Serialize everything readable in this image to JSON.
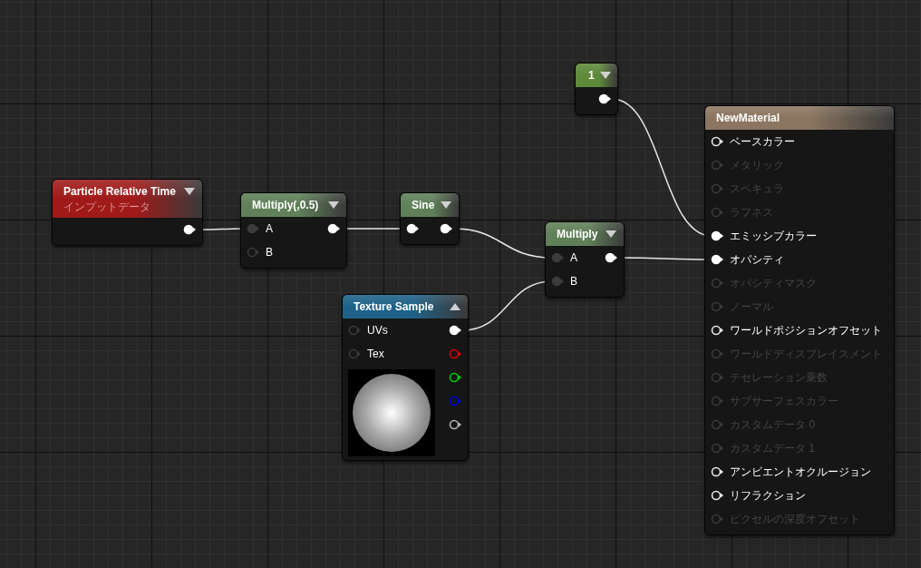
{
  "nodes": [
    {
      "kind": "constant",
      "title": "1",
      "color": "#5e8a3a",
      "expanded": false,
      "outputs": [
        {
          "connected": true,
          "color": "#ffffff"
        }
      ]
    },
    {
      "kind": "expression",
      "title": "Particle Relative Time",
      "subtitle": "インプットデータ",
      "color": "#a01a1a",
      "expanded": false,
      "outputs": [
        {
          "connected": true,
          "color": "#ffffff"
        }
      ]
    },
    {
      "kind": "expression",
      "title": "Multiply(,0.5)",
      "color": "#5f8058",
      "expanded": false,
      "inputs": [
        {
          "label": "A",
          "connected": true
        },
        {
          "label": "B",
          "connected": false
        }
      ],
      "outputs": [
        {
          "connected": true,
          "color": "#ffffff"
        }
      ]
    },
    {
      "kind": "expression",
      "title": "Sine",
      "color": "#5f8058",
      "expanded": false,
      "inputs": [
        {
          "connected": true
        }
      ],
      "outputs": [
        {
          "connected": true,
          "color": "#ffffff"
        }
      ]
    },
    {
      "kind": "expression",
      "title": "Multiply",
      "color": "#5f8058",
      "expanded": false,
      "inputs": [
        {
          "label": "A",
          "connected": true
        },
        {
          "label": "B",
          "connected": true
        }
      ],
      "outputs": [
        {
          "connected": true,
          "color": "#ffffff"
        }
      ]
    },
    {
      "kind": "texture",
      "title": "Texture Sample",
      "color": "#1e6289",
      "expanded": true,
      "inputs": [
        {
          "label": "UVs",
          "connected": false
        },
        {
          "label": "Tex",
          "connected": false
        }
      ],
      "outputs": [
        {
          "connected": true,
          "color": "#ffffff"
        },
        {
          "connected": false,
          "color": "#e00000"
        },
        {
          "connected": false,
          "color": "#00d000"
        },
        {
          "connected": false,
          "color": "#0000e0"
        },
        {
          "connected": false,
          "color": "#b4b4b4"
        }
      ]
    },
    {
      "kind": "material",
      "title": "NewMaterial",
      "color": "#8c7661",
      "inputs": [
        {
          "label": "ベースカラー",
          "enabled": true,
          "connected": false
        },
        {
          "label": "メタリック",
          "enabled": false,
          "connected": false
        },
        {
          "label": "スペキュラ",
          "enabled": false,
          "connected": false
        },
        {
          "label": "ラフネス",
          "enabled": false,
          "connected": false
        },
        {
          "label": "エミッシブカラー",
          "enabled": true,
          "connected": true
        },
        {
          "label": "オパシティ",
          "enabled": true,
          "connected": true
        },
        {
          "label": "オパシティマスク",
          "enabled": false,
          "connected": false
        },
        {
          "label": "ノーマル",
          "enabled": false,
          "connected": false
        },
        {
          "label": "ワールドポジションオフセット",
          "enabled": true,
          "connected": false
        },
        {
          "label": "ワールドディスプレイスメント",
          "enabled": false,
          "connected": false
        },
        {
          "label": "テセレーション乗数",
          "enabled": false,
          "connected": false
        },
        {
          "label": "サブサーフェスカラー",
          "enabled": false,
          "connected": false
        },
        {
          "label": "カスタムデータ 0",
          "enabled": false,
          "connected": false
        },
        {
          "label": "カスタムデータ 1",
          "enabled": false,
          "connected": false
        },
        {
          "label": "アンビエントオクルージョン",
          "enabled": true,
          "connected": false
        },
        {
          "label": "リフラクション",
          "enabled": true,
          "connected": false
        },
        {
          "label": "ピクセルの深度オフセット",
          "enabled": false,
          "connected": false
        }
      ]
    }
  ]
}
